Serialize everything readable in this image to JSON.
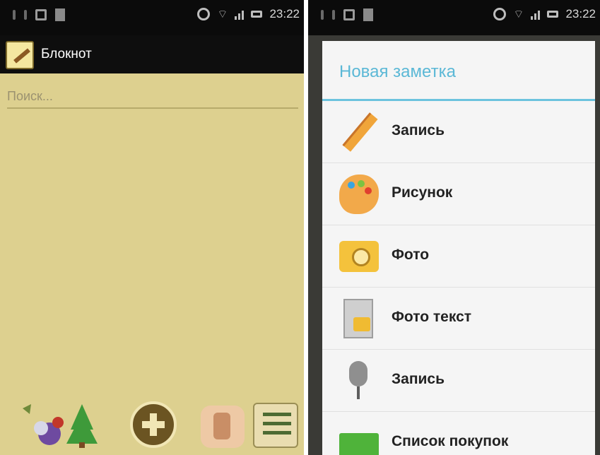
{
  "left_screen": {
    "status_bar": {
      "time": "23:22"
    },
    "app_bar": {
      "title": "Блокнот"
    },
    "search": {
      "placeholder": "Поиск..."
    },
    "bottom_bar": {
      "icons": [
        "christmas-decor-icon",
        "add-icon",
        "thumbs-up-icon",
        "checklist-icon"
      ]
    }
  },
  "right_screen": {
    "status_bar": {
      "time": "23:22"
    },
    "dialog": {
      "title": "Новая заметка",
      "items": [
        {
          "label": "Запись",
          "icon": "pencil-icon"
        },
        {
          "label": "Рисунок",
          "icon": "palette-icon"
        },
        {
          "label": "Фото",
          "icon": "camera-icon"
        },
        {
          "label": "Фото текст",
          "icon": "photo-text-icon"
        },
        {
          "label": "Запись",
          "icon": "microphone-icon"
        },
        {
          "label": "Список покупок",
          "icon": "shopping-cart-icon"
        }
      ]
    }
  },
  "colors": {
    "paper": "#ddd08f",
    "dialog_accent": "#5bb8d6",
    "status_bar": "#0b0b0b"
  }
}
